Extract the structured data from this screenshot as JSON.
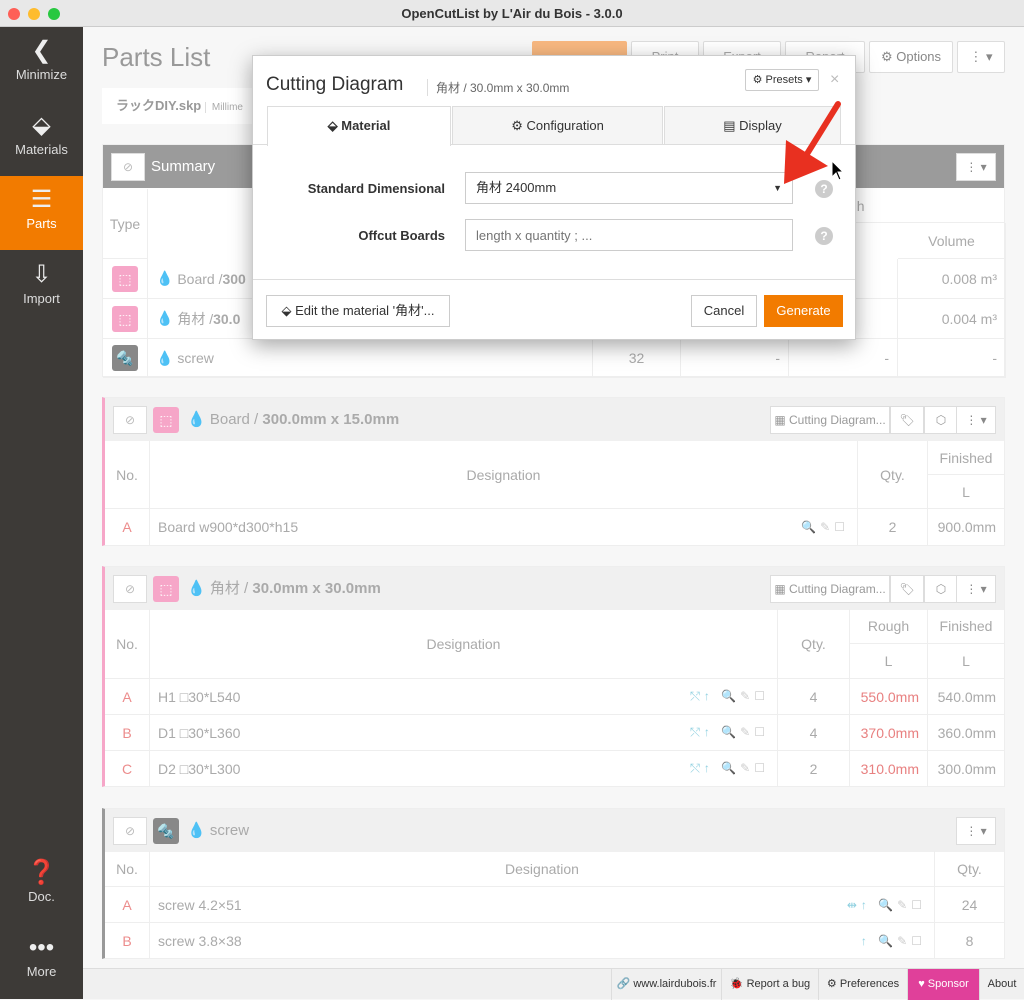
{
  "window": {
    "title": "OpenCutList by L'Air du Bois - 3.0.0"
  },
  "sidebar": {
    "items": [
      {
        "label": "Minimize",
        "icon": "chevron-left-icon"
      },
      {
        "label": "Materials",
        "icon": "materials-icon"
      },
      {
        "label": "Parts",
        "icon": "parts-list-icon",
        "active": true
      },
      {
        "label": "Import",
        "icon": "import-icon"
      },
      {
        "label": "Doc.",
        "icon": "question-icon"
      },
      {
        "label": "More",
        "icon": "more-dots-icon"
      }
    ]
  },
  "header": {
    "title": "Parts List",
    "buttons": {
      "print": "Print",
      "export": "Export",
      "report": "Report",
      "options": "Options"
    },
    "file": "ラックDIY.skp",
    "units": "Millime"
  },
  "summary": {
    "title": "Summary",
    "type_header": "Type",
    "rough_partial": "gh",
    "volume_header": "Volume",
    "rows": [
      {
        "name": "Board / ",
        "dims": "300",
        "qty": "",
        "c3": "-",
        "volume": "0.008 m³"
      },
      {
        "name": "角材 / ",
        "dims": "30.0",
        "qty": "",
        "c3": "-",
        "volume": "0.004 m³"
      },
      {
        "name": "screw",
        "dims": "",
        "qty": "32",
        "c2": "-",
        "c3": "-",
        "volume": "-"
      }
    ]
  },
  "groups": [
    {
      "material": "Board",
      "dims": "300.0mm x 15.0mm",
      "cutting_btn": "Cutting Diagram...",
      "headers": {
        "no": "No.",
        "designation": "Designation",
        "qty": "Qty.",
        "finished": "Finished",
        "l": "L"
      },
      "rows": [
        {
          "no": "A",
          "name": "Board w900*d300*h15",
          "qty": "2",
          "finished": "900.0mm"
        }
      ]
    },
    {
      "material": "角材",
      "dims": "30.0mm x 30.0mm",
      "cutting_btn": "Cutting Diagram...",
      "headers": {
        "no": "No.",
        "designation": "Designation",
        "qty": "Qty.",
        "rough": "Rough",
        "finished": "Finished",
        "l": "L"
      },
      "rows": [
        {
          "no": "A",
          "name": "H1 □30*L540",
          "qty": "4",
          "rough": "550.0mm",
          "finished": "540.0mm"
        },
        {
          "no": "B",
          "name": "D1 □30*L360",
          "qty": "4",
          "rough": "370.0mm",
          "finished": "360.0mm"
        },
        {
          "no": "C",
          "name": "D2 □30*L300",
          "qty": "2",
          "rough": "310.0mm",
          "finished": "300.0mm"
        }
      ]
    },
    {
      "material": "screw",
      "headers": {
        "no": "No.",
        "designation": "Designation",
        "qty": "Qty."
      },
      "rows": [
        {
          "no": "A",
          "name": "screw 4.2×51",
          "qty": "24"
        },
        {
          "no": "B",
          "name": "screw 3.8×38",
          "qty": "8"
        }
      ]
    }
  ],
  "footer": {
    "website": "www.lairdubois.fr",
    "bug": "Report a bug",
    "preferences": "Preferences",
    "sponsor": "Sponsor",
    "about": "About"
  },
  "modal": {
    "title": "Cutting Diagram",
    "subtitle": "角材 / 30.0mm x 30.0mm",
    "presets": "Presets",
    "close": "×",
    "tabs": [
      "Material",
      "Configuration",
      "Display"
    ],
    "active_tab": "Material",
    "std_label": "Standard Dimensional",
    "std_value": "角材 2400mm",
    "offcut_label": "Offcut Boards",
    "offcut_placeholder": "length x quantity ; ...",
    "offcut_value": "",
    "edit_btn": "Edit the material '角材'...",
    "cancel": "Cancel",
    "generate": "Generate"
  },
  "colors": {
    "accent": "#f27b00",
    "sponsor": "#e0409a",
    "sidebar": "#3d3a37",
    "annotation_arrow": "#e83020"
  }
}
